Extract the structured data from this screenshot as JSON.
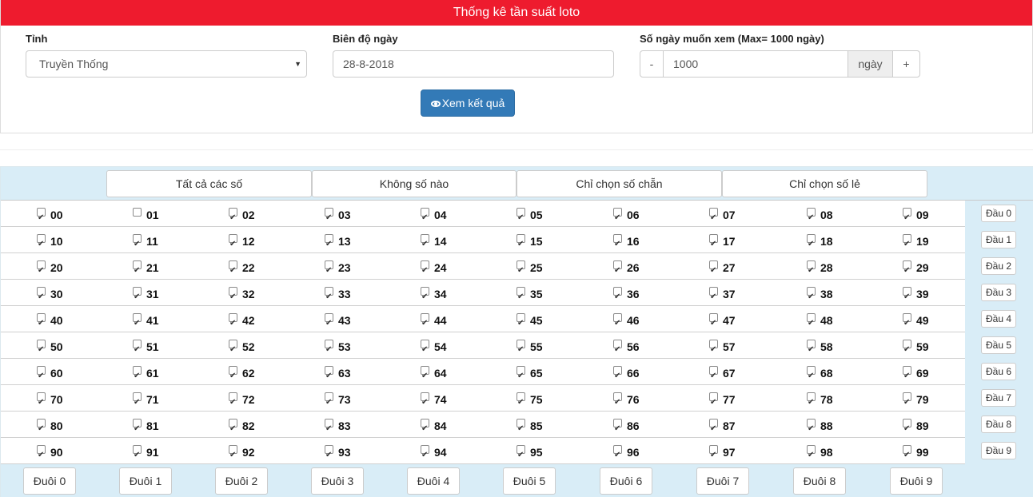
{
  "header": {
    "title": "Thống kê tần suất loto"
  },
  "form": {
    "province": {
      "label": "Tỉnh",
      "value": "Truyền Thống"
    },
    "date": {
      "label": "Biên độ ngày",
      "value": "28-8-2018"
    },
    "days": {
      "label": "Số ngày muốn xem (Max= 1000 ngày)",
      "minus": "-",
      "value": "1000",
      "unit": "ngày",
      "plus": "+"
    },
    "submit": "Xem kết quả"
  },
  "selectors": [
    "Tất cả các số",
    "Không số nào",
    "Chỉ chọn số chẵn",
    "Chỉ chọn số lẻ"
  ],
  "numbers": [
    [
      "00",
      "01",
      "02",
      "03",
      "04",
      "05",
      "06",
      "07",
      "08",
      "09"
    ],
    [
      "10",
      "11",
      "12",
      "13",
      "14",
      "15",
      "16",
      "17",
      "18",
      "19"
    ],
    [
      "20",
      "21",
      "22",
      "23",
      "24",
      "25",
      "26",
      "27",
      "28",
      "29"
    ],
    [
      "30",
      "31",
      "32",
      "33",
      "34",
      "35",
      "36",
      "37",
      "38",
      "39"
    ],
    [
      "40",
      "41",
      "42",
      "43",
      "44",
      "45",
      "46",
      "47",
      "48",
      "49"
    ],
    [
      "50",
      "51",
      "52",
      "53",
      "54",
      "55",
      "56",
      "57",
      "58",
      "59"
    ],
    [
      "60",
      "61",
      "62",
      "63",
      "64",
      "65",
      "66",
      "67",
      "68",
      "69"
    ],
    [
      "70",
      "71",
      "72",
      "73",
      "74",
      "75",
      "76",
      "77",
      "78",
      "79"
    ],
    [
      "80",
      "81",
      "82",
      "83",
      "84",
      "85",
      "86",
      "87",
      "88",
      "89"
    ],
    [
      "90",
      "91",
      "92",
      "93",
      "94",
      "95",
      "96",
      "97",
      "98",
      "99"
    ]
  ],
  "unchecked": [
    "01"
  ],
  "dau_buttons": [
    "Đầu 0",
    "Đầu 1",
    "Đầu 2",
    "Đầu 3",
    "Đầu 4",
    "Đầu 5",
    "Đầu 6",
    "Đầu 7",
    "Đầu 8",
    "Đầu 9"
  ],
  "duoi_buttons": [
    "Đuôi 0",
    "Đuôi 1",
    "Đuôi 2",
    "Đuôi 3",
    "Đuôi 4",
    "Đuôi 5",
    "Đuôi 6",
    "Đuôi 7",
    "Đuôi 8",
    "Đuôi 9"
  ],
  "colors": {
    "header": "#ee1b2e",
    "primary": "#337ab7",
    "band": "#d9edf7"
  }
}
